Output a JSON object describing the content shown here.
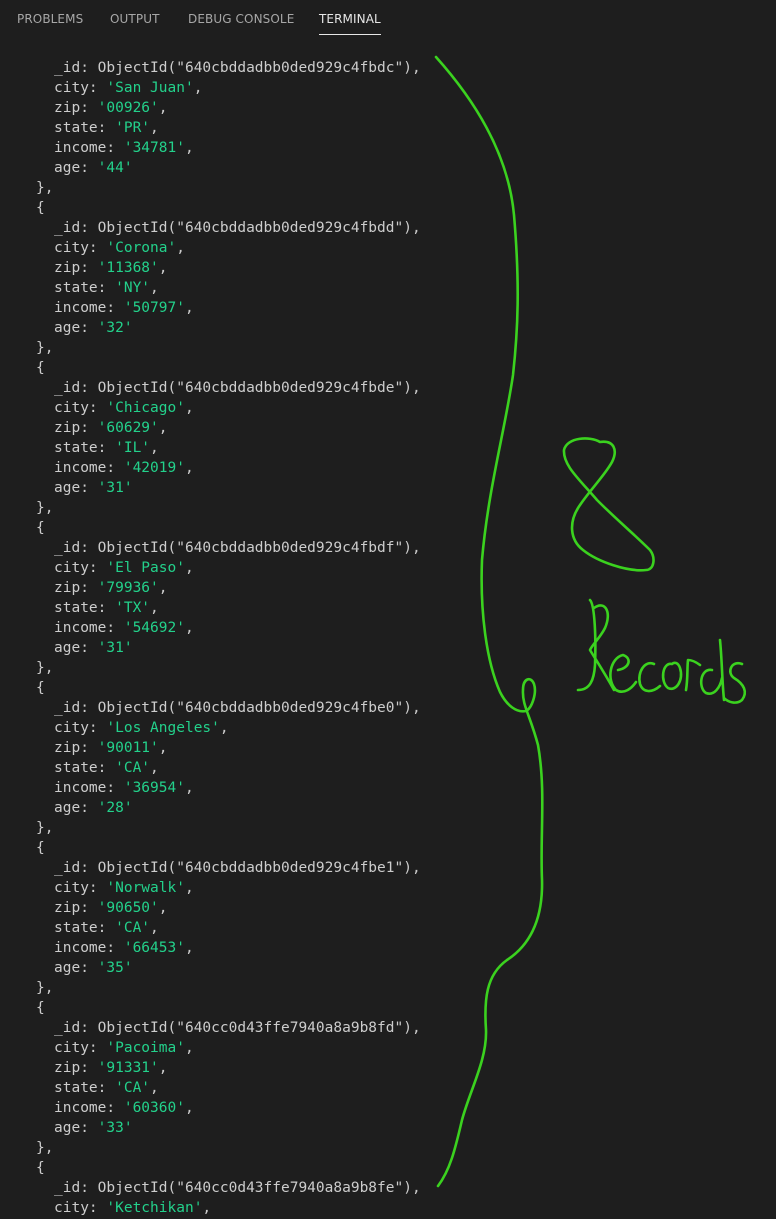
{
  "tabs": [
    {
      "label": "PROBLEMS"
    },
    {
      "label": "OUTPUT"
    },
    {
      "label": "DEBUG CONSOLE"
    },
    {
      "label": "TERMINAL"
    }
  ],
  "active_tab": "TERMINAL",
  "syntax": {
    "punct_color": "#cccccc",
    "string_color": "#23d18b"
  },
  "punct": {
    "id_key": "_id: ",
    "oid_open": "ObjectId(\"",
    "oid_close": "\"),",
    "city_key": "city: ",
    "zip_key": "zip: ",
    "state_key": "state: ",
    "income_key": "income: ",
    "age_key": "age: ",
    "comma": ",",
    "obj_close": "},",
    "obj_open": "{"
  },
  "records": [
    {
      "oid": "640cbddadbb0ded929c4fbdc",
      "city": "'San Juan'",
      "zip": "'00926'",
      "state": "'PR'",
      "income": "'34781'",
      "age": "'44'"
    },
    {
      "oid": "640cbddadbb0ded929c4fbdd",
      "city": "'Corona'",
      "zip": "'11368'",
      "state": "'NY'",
      "income": "'50797'",
      "age": "'32'"
    },
    {
      "oid": "640cbddadbb0ded929c4fbde",
      "city": "'Chicago'",
      "zip": "'60629'",
      "state": "'IL'",
      "income": "'42019'",
      "age": "'31'"
    },
    {
      "oid": "640cbddadbb0ded929c4fbdf",
      "city": "'El Paso'",
      "zip": "'79936'",
      "state": "'TX'",
      "income": "'54692'",
      "age": "'31'"
    },
    {
      "oid": "640cbddadbb0ded929c4fbe0",
      "city": "'Los Angeles'",
      "zip": "'90011'",
      "state": "'CA'",
      "income": "'36954'",
      "age": "'28'"
    },
    {
      "oid": "640cbddadbb0ded929c4fbe1",
      "city": "'Norwalk'",
      "zip": "'90650'",
      "state": "'CA'",
      "income": "'66453'",
      "age": "'35'"
    },
    {
      "oid": "640cc0d43ffe7940a8a9b8fd",
      "city": "'Pacoima'",
      "zip": "'91331'",
      "state": "'CA'",
      "income": "'60360'",
      "age": "'33'"
    },
    {
      "oid": "640cc0d43ffe7940a8a9b8fe",
      "city": "'Ketchikan'"
    }
  ],
  "annotation": {
    "count_text": "8",
    "label_text": "Records",
    "color": "#3bd21f"
  }
}
